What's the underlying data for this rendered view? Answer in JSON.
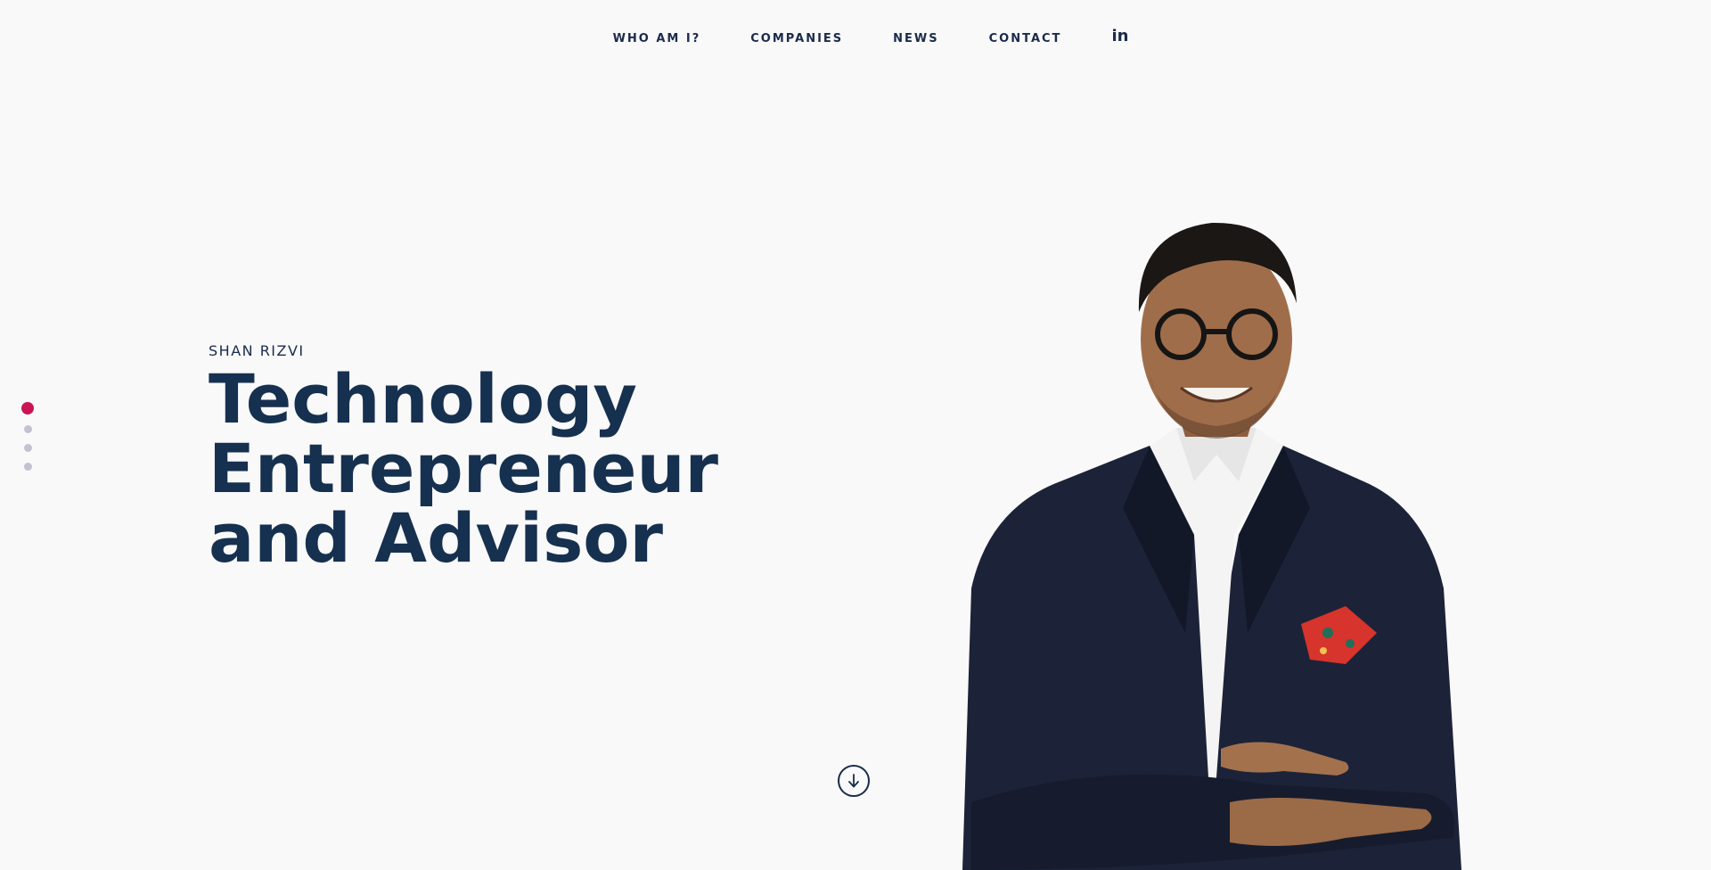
{
  "nav": {
    "items": [
      {
        "label": "WHO AM I?"
      },
      {
        "label": "COMPANIES"
      },
      {
        "label": "NEWS"
      },
      {
        "label": "CONTACT"
      }
    ],
    "linkedin_label": "in"
  },
  "hero": {
    "eyebrow": "SHAN RIZVI",
    "headline_lines": [
      "Technology",
      "Entrepreneur",
      "and Advisor"
    ]
  },
  "slider": {
    "total": 4,
    "active_index": 0
  },
  "colors": {
    "background": "#f9f9fa",
    "text_dark": "#16304f",
    "accent": "#cc1455",
    "dot_inactive": "#c4c2d0"
  },
  "icons": {
    "scroll": "arrow-down-circle-icon",
    "social": "linkedin-icon"
  }
}
